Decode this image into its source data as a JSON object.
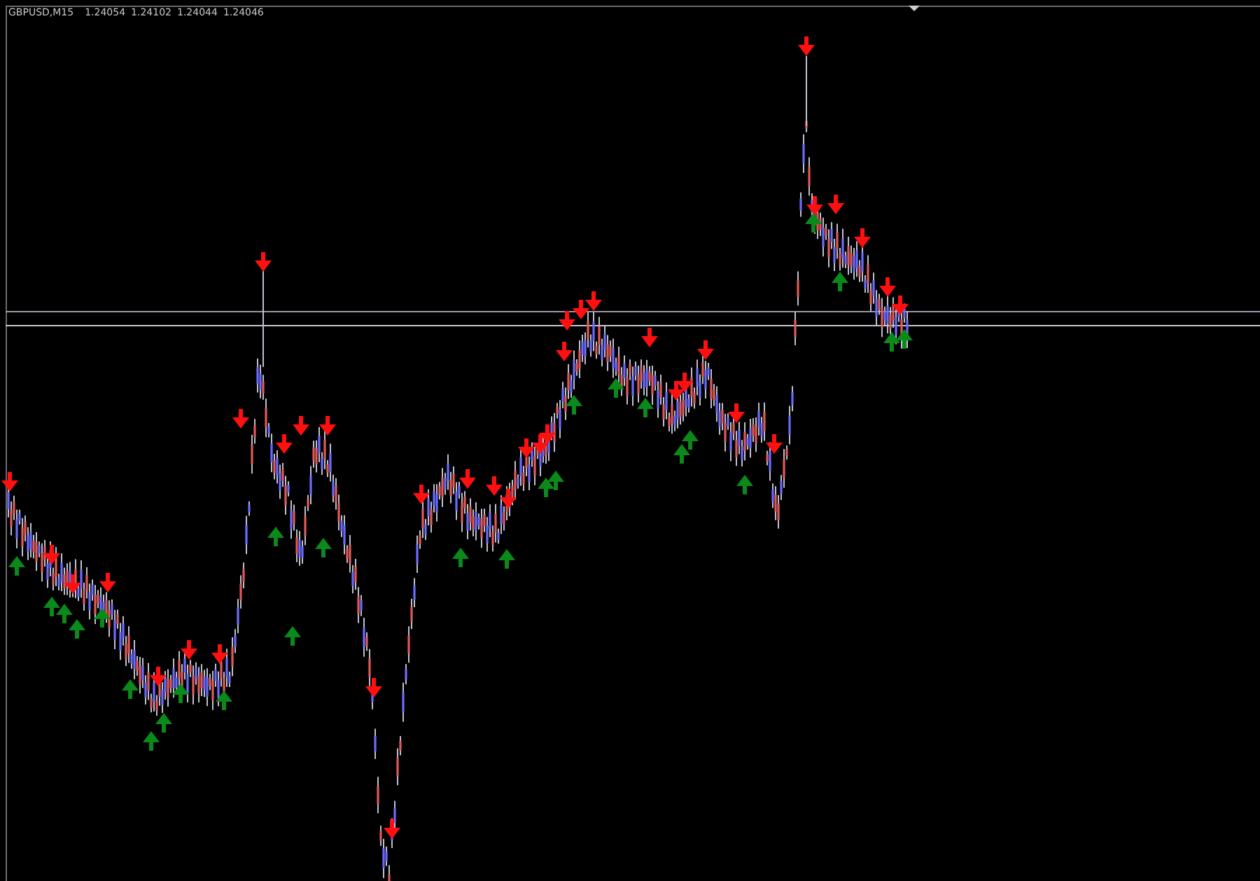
{
  "chart": {
    "symbol": "GBPUSD,M15",
    "quotes": [
      "1.24054",
      "1.24102",
      "1.24044",
      "1.24046"
    ]
  }
}
